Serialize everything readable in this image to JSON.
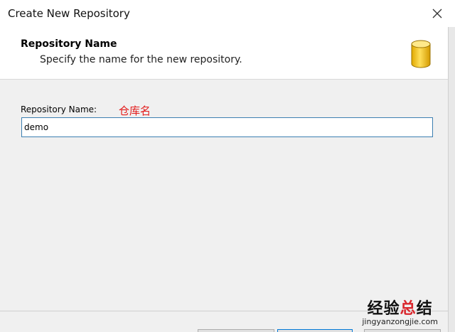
{
  "window": {
    "title": "Create New Repository",
    "close_icon": "close-icon"
  },
  "header": {
    "title": "Repository Name",
    "subtitle": "Specify the name for the new repository.",
    "icon": "database-icon"
  },
  "form": {
    "repository_name_label": "Repository Name:",
    "repository_name_value": "demo",
    "annotation": "仓库名"
  },
  "watermark": {
    "title_part1": "经验",
    "title_part2": "总",
    "title_part3": "结",
    "url": "jingyanzongjie.com"
  },
  "colors": {
    "annotation": "#e31b1b",
    "input_border": "#3c7fb1",
    "db_icon": "#f2c230"
  }
}
